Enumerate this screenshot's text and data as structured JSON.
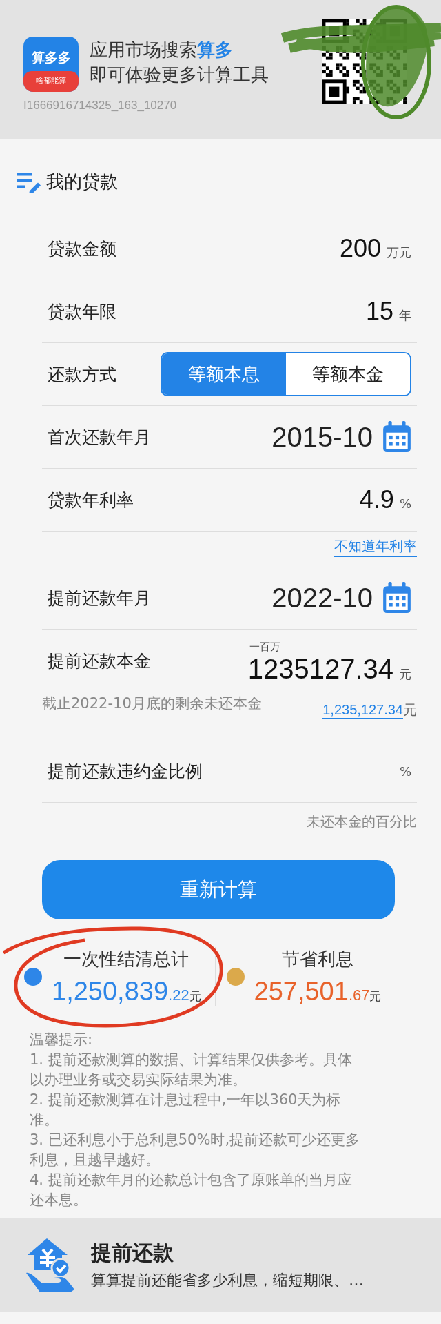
{
  "banner": {
    "logo_title": "算多多",
    "logo_subtitle": "啥都能算",
    "line_1_prefix": "应用市场搜索",
    "line_1_highlight": "算多",
    "line_2": "即可体验更多计算工具",
    "code": "I1666916714325_163_10270"
  },
  "section_title": "我的贷款",
  "fields": [
    {
      "kind": "value",
      "label": "贷款金额",
      "value": "200",
      "unit": "万元"
    },
    {
      "kind": "value",
      "label": "贷款年限",
      "value": "15",
      "unit": "年"
    },
    {
      "kind": "segmented",
      "label": "还款方式",
      "options": [
        {
          "label": "等额本息",
          "selected": true
        },
        {
          "label": "等额本金",
          "selected": false
        }
      ]
    },
    {
      "kind": "date",
      "label": "首次还款年月",
      "value": "2015-10"
    },
    {
      "kind": "value",
      "label": "贷款年利率",
      "value": "4.9",
      "unit": "%",
      "link": "不知道年利率"
    },
    {
      "kind": "date",
      "label": "提前还款年月",
      "value": "2022-10"
    },
    {
      "kind": "value",
      "label": "提前还款本金",
      "hint": "一百万",
      "value": "1235127.34",
      "unit": "元",
      "note": "截止2022-10月底的剩余未还本金",
      "note_value": "1,235,127.34",
      "note_unit": "元"
    },
    {
      "kind": "value",
      "label": "提前还款违约金比例",
      "unit": "%",
      "caption": "未还本金的百分比"
    }
  ],
  "button": "重新计算",
  "results": [
    {
      "label": "一次性结清总计",
      "color": "#2e86e8",
      "kind": "total",
      "whole": "1,250,839",
      "fraction": ".22",
      "unit": "元"
    },
    {
      "label": "节省利息",
      "color": "#dba94b",
      "kind": "savings",
      "whole": "257,501",
      "fraction": ".67",
      "unit": "元"
    }
  ],
  "tips": {
    "title": "温馨提示:",
    "items": [
      "1. 提前还款测算的数据、计算结果仅供参考。具体以办理业务或交易实际结果为准。",
      "2. 提前还款测算在计息过程中,一年以360天为标准。",
      "3. 已还利息小于总利息50%时,提前还款可少还更多利息，且越早越好。",
      "4. 提前还款年月的还款总计包含了原账单的当月应还本息。"
    ]
  },
  "promo": {
    "title": "提前还款",
    "subtitle": "算算提前还能省多少利息，缩短期限、…"
  }
}
